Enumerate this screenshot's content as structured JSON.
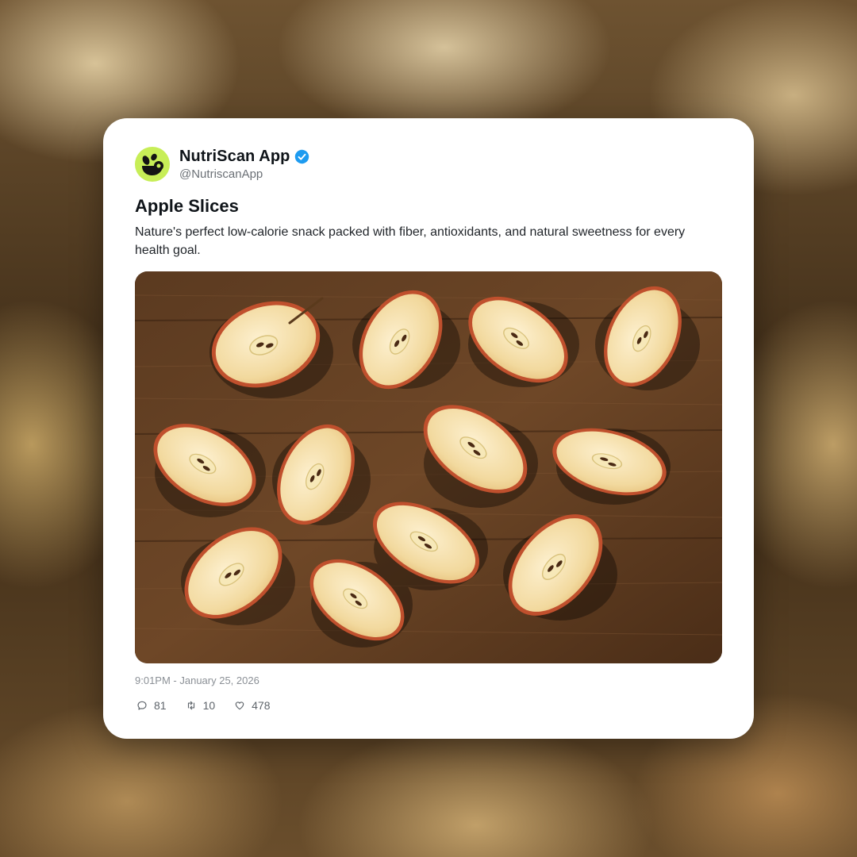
{
  "post": {
    "author_name": "NutriScan App",
    "author_handle": "@NutriscanApp",
    "verified": true,
    "title": "Apple Slices",
    "body": "Nature's perfect low-calorie snack packed with fiber, antioxidants, and natural sweetness for every health goal.",
    "timestamp": "9:01PM - January 25, 2026",
    "stats": {
      "replies": "81",
      "reposts": "10",
      "likes": "478"
    }
  },
  "colors": {
    "avatar_bg": "#c7ee57",
    "verified_badge": "#1d9bf0",
    "card_bg": "#ffffff",
    "text_primary": "#0f1419",
    "text_muted": "#8b9096"
  },
  "icons": {
    "avatar": "nutriscan-logo-icon",
    "verified": "verified-badge-icon",
    "replies": "comment-icon",
    "reposts": "repost-icon",
    "likes": "heart-icon"
  },
  "media": {
    "subject": "apple-slices-photo"
  }
}
